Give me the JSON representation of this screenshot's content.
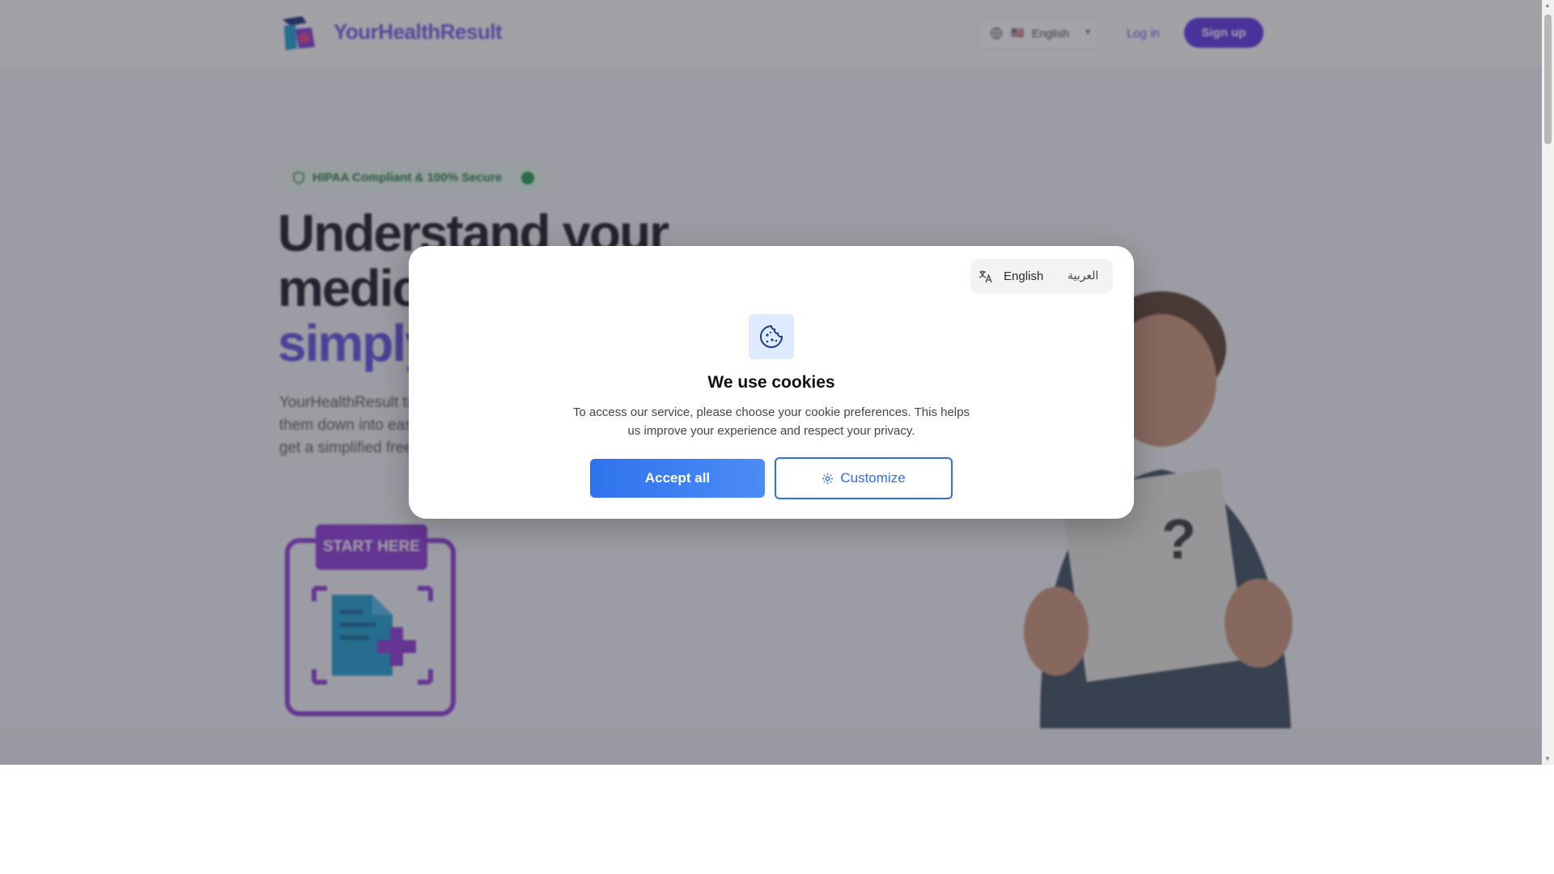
{
  "header": {
    "brand": "YourHealthResult",
    "language_flag": "🇺🇸",
    "language_label": "English",
    "login_label": "Log in",
    "signup_label": "Sign up"
  },
  "hero": {
    "badge": "HIPAA Compliant & 100% Secure",
    "title_line1": "Understand your",
    "title_line2": "medical results",
    "title_line3": "simply",
    "description": "YourHealthResult translates complex medical documents by breaking them down into easy to understand language. Upload your results and get a simplified free summary.",
    "start_tag": "START HERE"
  },
  "cookie_modal": {
    "language_options": [
      "English",
      "العربية"
    ],
    "title": "We use cookies",
    "text": "To access our service, please choose your cookie preferences. This helps us improve your experience and respect your privacy.",
    "accept_label": "Accept all",
    "customize_label": "Customize"
  },
  "colors": {
    "accent": "#5b4de0",
    "primary_button": "#2f73ec",
    "overlay": "rgba(55,55,65,0.46)"
  }
}
